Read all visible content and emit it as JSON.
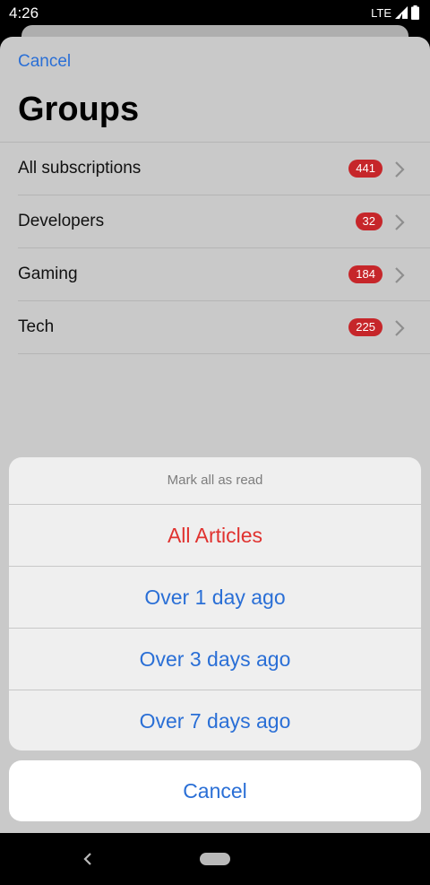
{
  "status_bar": {
    "time": "4:26",
    "network": "LTE"
  },
  "header": {
    "cancel_label": "Cancel",
    "title": "Groups"
  },
  "groups": [
    {
      "name": "All subscriptions",
      "count": "441"
    },
    {
      "name": "Developers",
      "count": "32"
    },
    {
      "name": "Gaming",
      "count": "184"
    },
    {
      "name": "Tech",
      "count": "225"
    }
  ],
  "action_sheet": {
    "title": "Mark all as read",
    "options": [
      {
        "label": "All Articles",
        "style": "destructive"
      },
      {
        "label": "Over 1 day ago",
        "style": "default"
      },
      {
        "label": "Over 3 days ago",
        "style": "default"
      },
      {
        "label": "Over 7 days ago",
        "style": "default"
      }
    ],
    "cancel_label": "Cancel"
  },
  "colors": {
    "accent": "#2a6fd6",
    "destructive": "#e0322f",
    "badge": "#c6262a"
  },
  "icons": {
    "signal": "signal-icon",
    "battery": "battery-icon",
    "chevron": "chevron-right-icon",
    "nav_back": "nav-back-icon",
    "nav_home": "nav-home-pill"
  }
}
